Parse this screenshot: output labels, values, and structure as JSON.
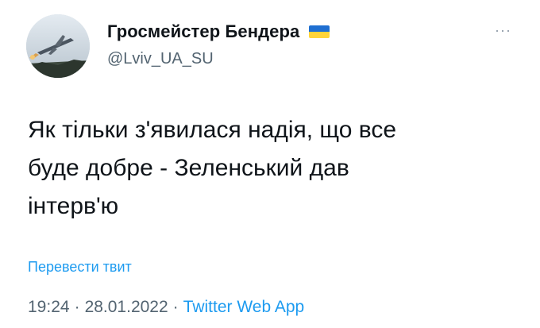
{
  "author": {
    "display_name": "Гросмейстер Бендера",
    "handle": "@Lviv_UA_SU",
    "badge_icon": "ukraine-flag-icon",
    "flag_colors": {
      "top": "#1f6fd1",
      "bottom": "#ffd43a"
    }
  },
  "menu": {
    "more_label": "···",
    "icon": "more-dots-icon"
  },
  "tweet": {
    "text": "Як тільки з'явилася надія, що все\nбуде добре - Зеленський дав\nінтерв'ю"
  },
  "translate": {
    "label": "Перевести твит"
  },
  "meta": {
    "time": "19:24",
    "separator": "·",
    "date": "28.01.2022",
    "source": "Twitter Web App"
  },
  "colors": {
    "text": "#0f1419",
    "secondary": "#536471",
    "link": "#1d9bf0"
  }
}
